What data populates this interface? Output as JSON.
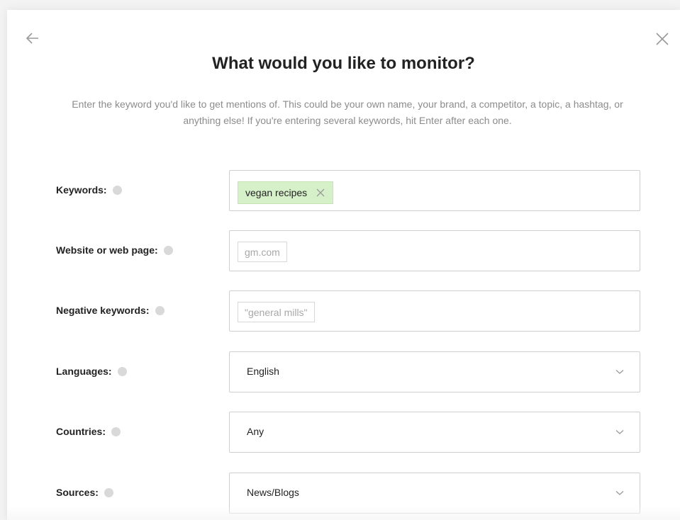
{
  "modal": {
    "title": "What would you like to monitor?",
    "subtitle": "Enter the keyword you'd like to get mentions of. This could be your own name, your brand, a competitor, a topic, a hashtag, or anything else! If you're entering several keywords, hit Enter after each one.",
    "back_icon": "arrow-left-icon",
    "close_icon": "close-icon"
  },
  "form": {
    "keywords": {
      "label": "Keywords:",
      "tags": [
        "vegan recipes"
      ]
    },
    "website": {
      "label": "Website or web page:",
      "placeholder": "gm.com"
    },
    "negative": {
      "label": "Negative keywords:",
      "placeholder": "\"general mills\""
    },
    "languages": {
      "label": "Languages:",
      "value": "English"
    },
    "countries": {
      "label": "Countries:",
      "value": "Any"
    },
    "sources": {
      "label": "Sources:",
      "value": "News/Blogs"
    }
  },
  "colors": {
    "tag_bg": "#d6f0c9",
    "text": "#222222",
    "muted": "#8c8c8c",
    "border": "#cfcfcf"
  }
}
